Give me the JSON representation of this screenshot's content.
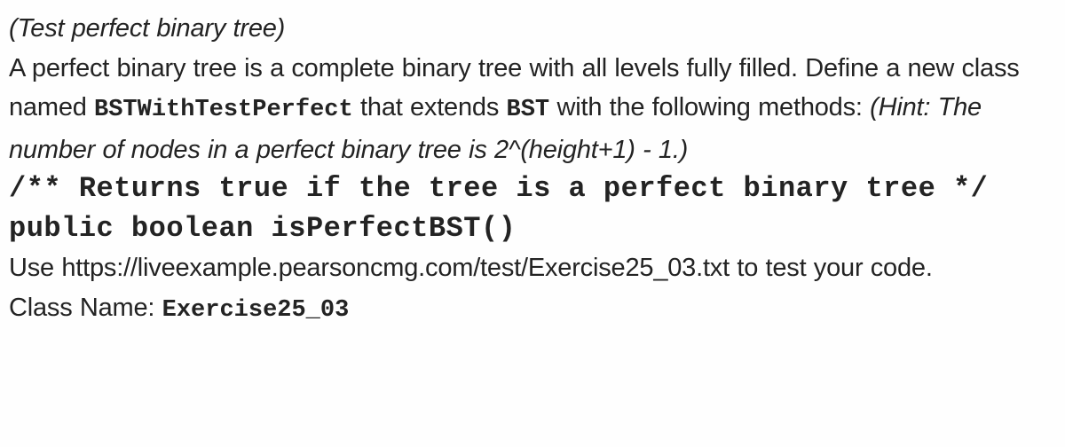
{
  "document": {
    "title_line": "(Test perfect binary tree)",
    "description": {
      "lead": "A perfect binary tree is a complete binary tree with all levels fully filled. Define a new class named ",
      "class_name_code": "BSTWithTestPerfect",
      "middle": " that extends ",
      "base_class_code": "BST",
      "tail": " with the following methods: ",
      "hint": "(Hint: The number of nodes in a perfect binary tree is 2^(height+1) - 1.)"
    },
    "code": {
      "comment": "/** Returns true if the tree is a perfect binary tree */",
      "signature": "public boolean isPerfectBST()"
    },
    "test_instructions": {
      "prefix": "Use ",
      "url": "https://liveexample.pearsoncmg.com/test/Exercise25_03.txt",
      "suffix": " to test your code."
    },
    "class_name_label": {
      "label": "Class Name: ",
      "value": "Exercise25_03"
    },
    "colors": {
      "text": "#232323",
      "background": "#fefefe"
    }
  }
}
